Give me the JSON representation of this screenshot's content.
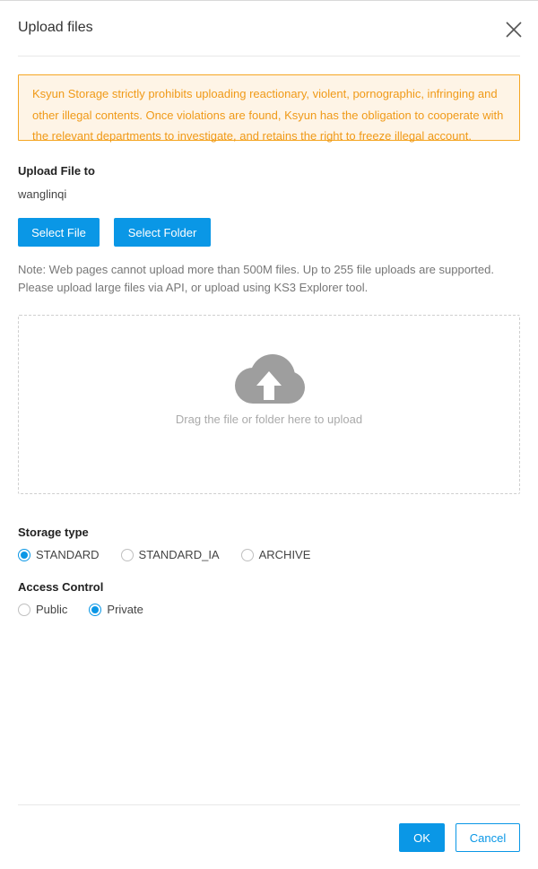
{
  "dialog": {
    "title": "Upload files",
    "close_icon": "close-icon"
  },
  "warning": {
    "text": "Ksyun Storage strictly prohibits uploading reactionary, violent, pornographic, infringing and other illegal contents. Once violations are found, Ksyun has the obligation to cooperate with the relevant departments to investigate, and retains the right to freeze illegal account.",
    "color": "#f09a18",
    "border_color": "#f5a623",
    "background": "#fef4e6"
  },
  "upload_to": {
    "label": "Upload File to",
    "bucket": "wanglinqi"
  },
  "buttons": {
    "select_file": "Select File",
    "select_folder": "Select Folder",
    "ok": "OK",
    "cancel": "Cancel"
  },
  "note": "Note: Web pages cannot upload more than 500M files. Up to 255 file uploads are supported. Please upload large files via API, or upload using KS3 Explorer tool.",
  "dropzone": {
    "icon": "cloud-upload-icon",
    "text": "Drag the file or folder here to upload"
  },
  "storage_type": {
    "label": "Storage type",
    "options": [
      "STANDARD",
      "STANDARD_IA",
      "ARCHIVE"
    ],
    "selected": "STANDARD"
  },
  "access_control": {
    "label": "Access Control",
    "options": [
      "Public",
      "Private"
    ],
    "selected": "Private"
  },
  "colors": {
    "accent": "#0a97e6",
    "icon_gray": "#9e9e9e"
  }
}
